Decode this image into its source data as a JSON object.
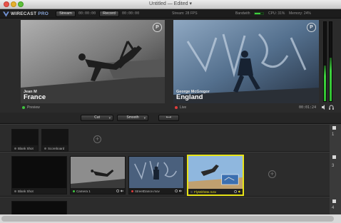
{
  "window": {
    "title": "Untitled — Edited ▾"
  },
  "toolbar": {
    "app_name": "WIRECAST",
    "app_edition": "PRO",
    "stream_label": "Stream",
    "stream_time": "00:00:00",
    "record_label": "Record",
    "record_time": "00:00:00",
    "stream_fps": "Stream:   28 FPS",
    "bandwidth_label": "Bandwith",
    "cpu": "CPU: 31%",
    "memory": "Memory: 24%",
    "bandwidth_level": 0.7
  },
  "preview": {
    "name": "Jean M",
    "place": "France",
    "status": "Preview",
    "status_color": "#3ec43e",
    "badge": "P"
  },
  "live": {
    "name": "George McGregor",
    "place": "England",
    "status": "Live",
    "status_color": "#e03c3c",
    "timecode": "00:01:24",
    "badge": "P"
  },
  "audio_meters": {
    "left_level": 0.45,
    "right_level": 0.55
  },
  "transitions": {
    "cut_label": "Cut",
    "smooth_label": "Smooth",
    "swap_label": "⟷"
  },
  "layers": {
    "row1": {
      "number": "1",
      "shots": [
        {
          "label": "Blank Shot"
        },
        {
          "label": "Scoreboard"
        }
      ]
    },
    "row2": {
      "number": "3",
      "shots": [
        {
          "label": "Blank Shot"
        },
        {
          "label": "Camera 1"
        },
        {
          "label": "StreetDance.mov"
        },
        {
          "label": "FlyWithMe.m4v"
        }
      ]
    },
    "row3": {
      "number": "4"
    },
    "add_label": "+"
  },
  "colors": {
    "accent_selected": "#e8e418",
    "live_dot": "#e03c3c",
    "preview_dot": "#3ec43e"
  }
}
